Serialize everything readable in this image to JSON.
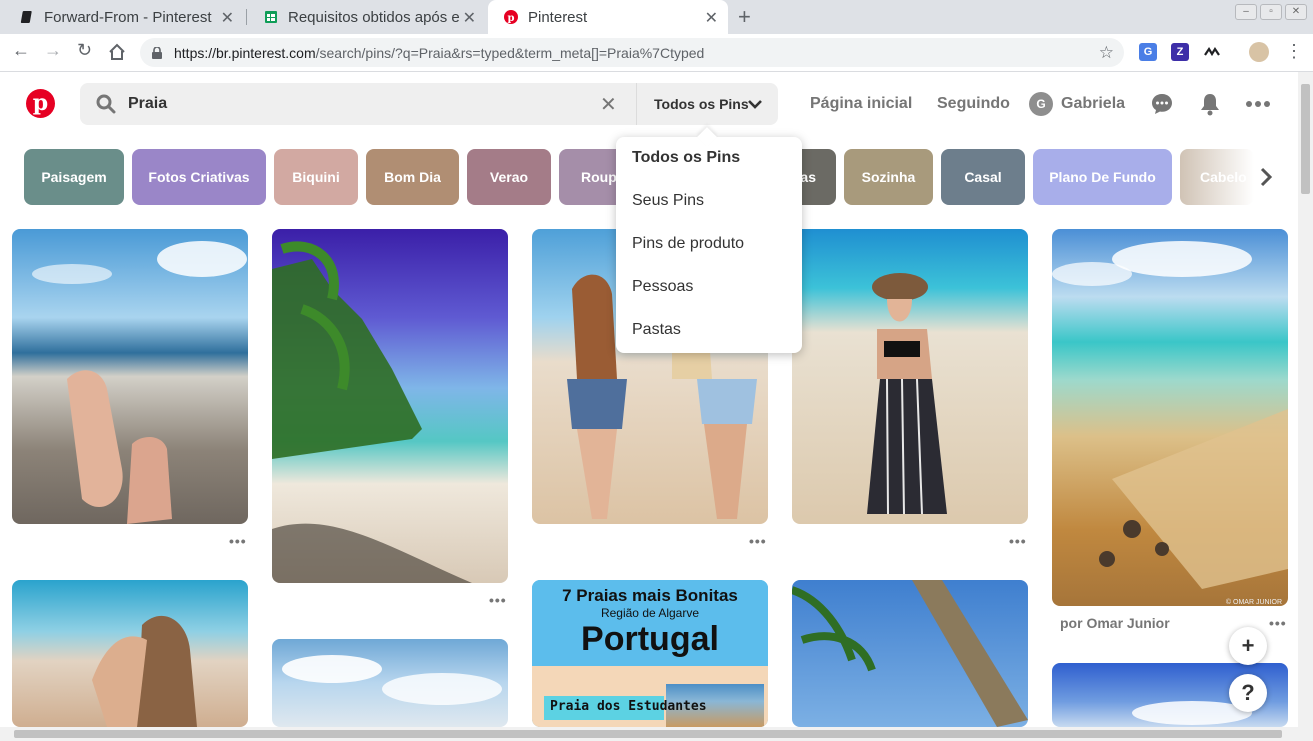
{
  "browser": {
    "tabs": [
      {
        "title": "Forward-From - Pinterest"
      },
      {
        "title": "Requisitos obtidos após e"
      },
      {
        "title": "Pinterest"
      }
    ],
    "url_host": "https://br.pinterest.com",
    "url_path": "/search/pins/?q=Praia&rs=typed&term_meta[]=Praia%7Ctyped"
  },
  "header": {
    "search_value": "Praia",
    "filter_label": "Todos os Pins",
    "home_link": "Página inicial",
    "following_link": "Seguindo",
    "avatar_initial": "G",
    "user_name": "Gabriela"
  },
  "chips": [
    {
      "label": "Paisagem",
      "color": "#6a8e8a"
    },
    {
      "label": "Fotos Criativas",
      "color": "#9a86c8"
    },
    {
      "label": "Biquini",
      "color": "#d2a9a2"
    },
    {
      "label": "Bom Dia",
      "color": "#b08e73"
    },
    {
      "label": "Verao",
      "color": "#a47c88"
    },
    {
      "label": "Roupa",
      "color": "#a58ea9"
    },
    {
      "label": "as",
      "color": "#6b6a64"
    },
    {
      "label": "Sozinha",
      "color": "#a89a7c"
    },
    {
      "label": "Casal",
      "color": "#6d7e8c"
    },
    {
      "label": "Plano De Fundo",
      "color": "#a8aeea"
    },
    {
      "label": "Cabelo",
      "color": "#d9d2cb"
    }
  ],
  "dropdown": {
    "items": [
      "Todos os Pins",
      "Seus Pins",
      "Pins de produto",
      "Pessoas",
      "Pastas"
    ]
  },
  "pins": {
    "col5_author": "por Omar Junior",
    "portugal": {
      "line1": "7 Praias mais Bonitas",
      "line2": "Região de Algarve",
      "line3": "Portugal",
      "line4": "Praia dos Estudantes"
    },
    "watermark": "© OMAR JUNIOR"
  },
  "fabs": {
    "add": "+",
    "help": "?"
  },
  "more_dots": "•••"
}
